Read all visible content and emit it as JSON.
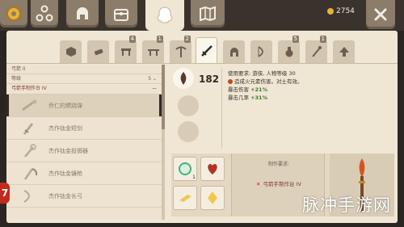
{
  "topbar": {
    "tabs": [
      {
        "icon": "gear-coins-icon"
      },
      {
        "icon": "network-icon"
      },
      {
        "icon": "helmet-icon"
      },
      {
        "icon": "chest-icon"
      },
      {
        "icon": "crafting-ghost-icon",
        "active": true
      },
      {
        "icon": "map-icon"
      }
    ],
    "coins": "2754",
    "close_icon": "close-icon"
  },
  "categories": [
    {
      "icon": "block-icon",
      "badge": ""
    },
    {
      "icon": "crossbow-icon",
      "badge": ""
    },
    {
      "icon": "table-icon",
      "badge": "4"
    },
    {
      "icon": "workbench-icon",
      "badge": "1"
    },
    {
      "icon": "pickaxe-icon",
      "badge": "2"
    },
    {
      "icon": "sword-icon",
      "badge": "",
      "active": true
    },
    {
      "icon": "helmet-icon",
      "badge": ""
    },
    {
      "icon": "bow-icon",
      "badge": ""
    },
    {
      "icon": "potion-icon",
      "badge": "5"
    },
    {
      "icon": "staff-icon",
      "badge": "1"
    },
    {
      "icon": "upgrade-arrow-icon",
      "badge": ""
    }
  ],
  "left": {
    "dropdown1": "弓箭 II",
    "dropdown1_count": "",
    "dropdown2": "等级",
    "dropdown2_count": "5",
    "group": "弓箭手制作台 IV",
    "group_toggle": "—",
    "recipes": [
      {
        "name": "乔仁的燃烧弹",
        "icon": "fire-bomb-icon",
        "selected": true
      },
      {
        "name": "杰作钛金短剑",
        "icon": "dagger-icon"
      },
      {
        "name": "杰作钛金投掷器",
        "icon": "thrower-icon"
      },
      {
        "name": "杰作钛金镰枪",
        "icon": "scythe-icon"
      },
      {
        "name": "杰作钛金长弓",
        "icon": "longbow-icon"
      }
    ]
  },
  "detail": {
    "item_icon": "fire-bomb-icon",
    "power": "182",
    "stats": {
      "requirement": "使用要求: 游侠, 人物等级 30",
      "effect": "造成火元素伤害。对土有效。",
      "crit_dmg_label": "暴击伤害",
      "crit_dmg_value": "+21%",
      "crit_rate_label": "暴击几率",
      "crit_rate_value": "+31%"
    },
    "materials": [
      {
        "icon": "green-gem-icon",
        "count": "1"
      },
      {
        "icon": "red-heart-icon",
        "count": ""
      },
      {
        "icon": "gold-bar-icon",
        "count": ""
      },
      {
        "icon": "yellow-crystal-icon",
        "count": ""
      }
    ],
    "req_title": "制作要求:",
    "req_line": "弓箭手制作台 IV",
    "req_status_icon": "x-icon",
    "preview_icon": "flame-torch-icon"
  },
  "side_tab": "7",
  "watermark": "脉冲手游网",
  "colors": {
    "panel": "#efe6d4",
    "topbar": "#3a332d",
    "accent_red": "#c22a1c",
    "green_stat": "#3d7a2a"
  }
}
